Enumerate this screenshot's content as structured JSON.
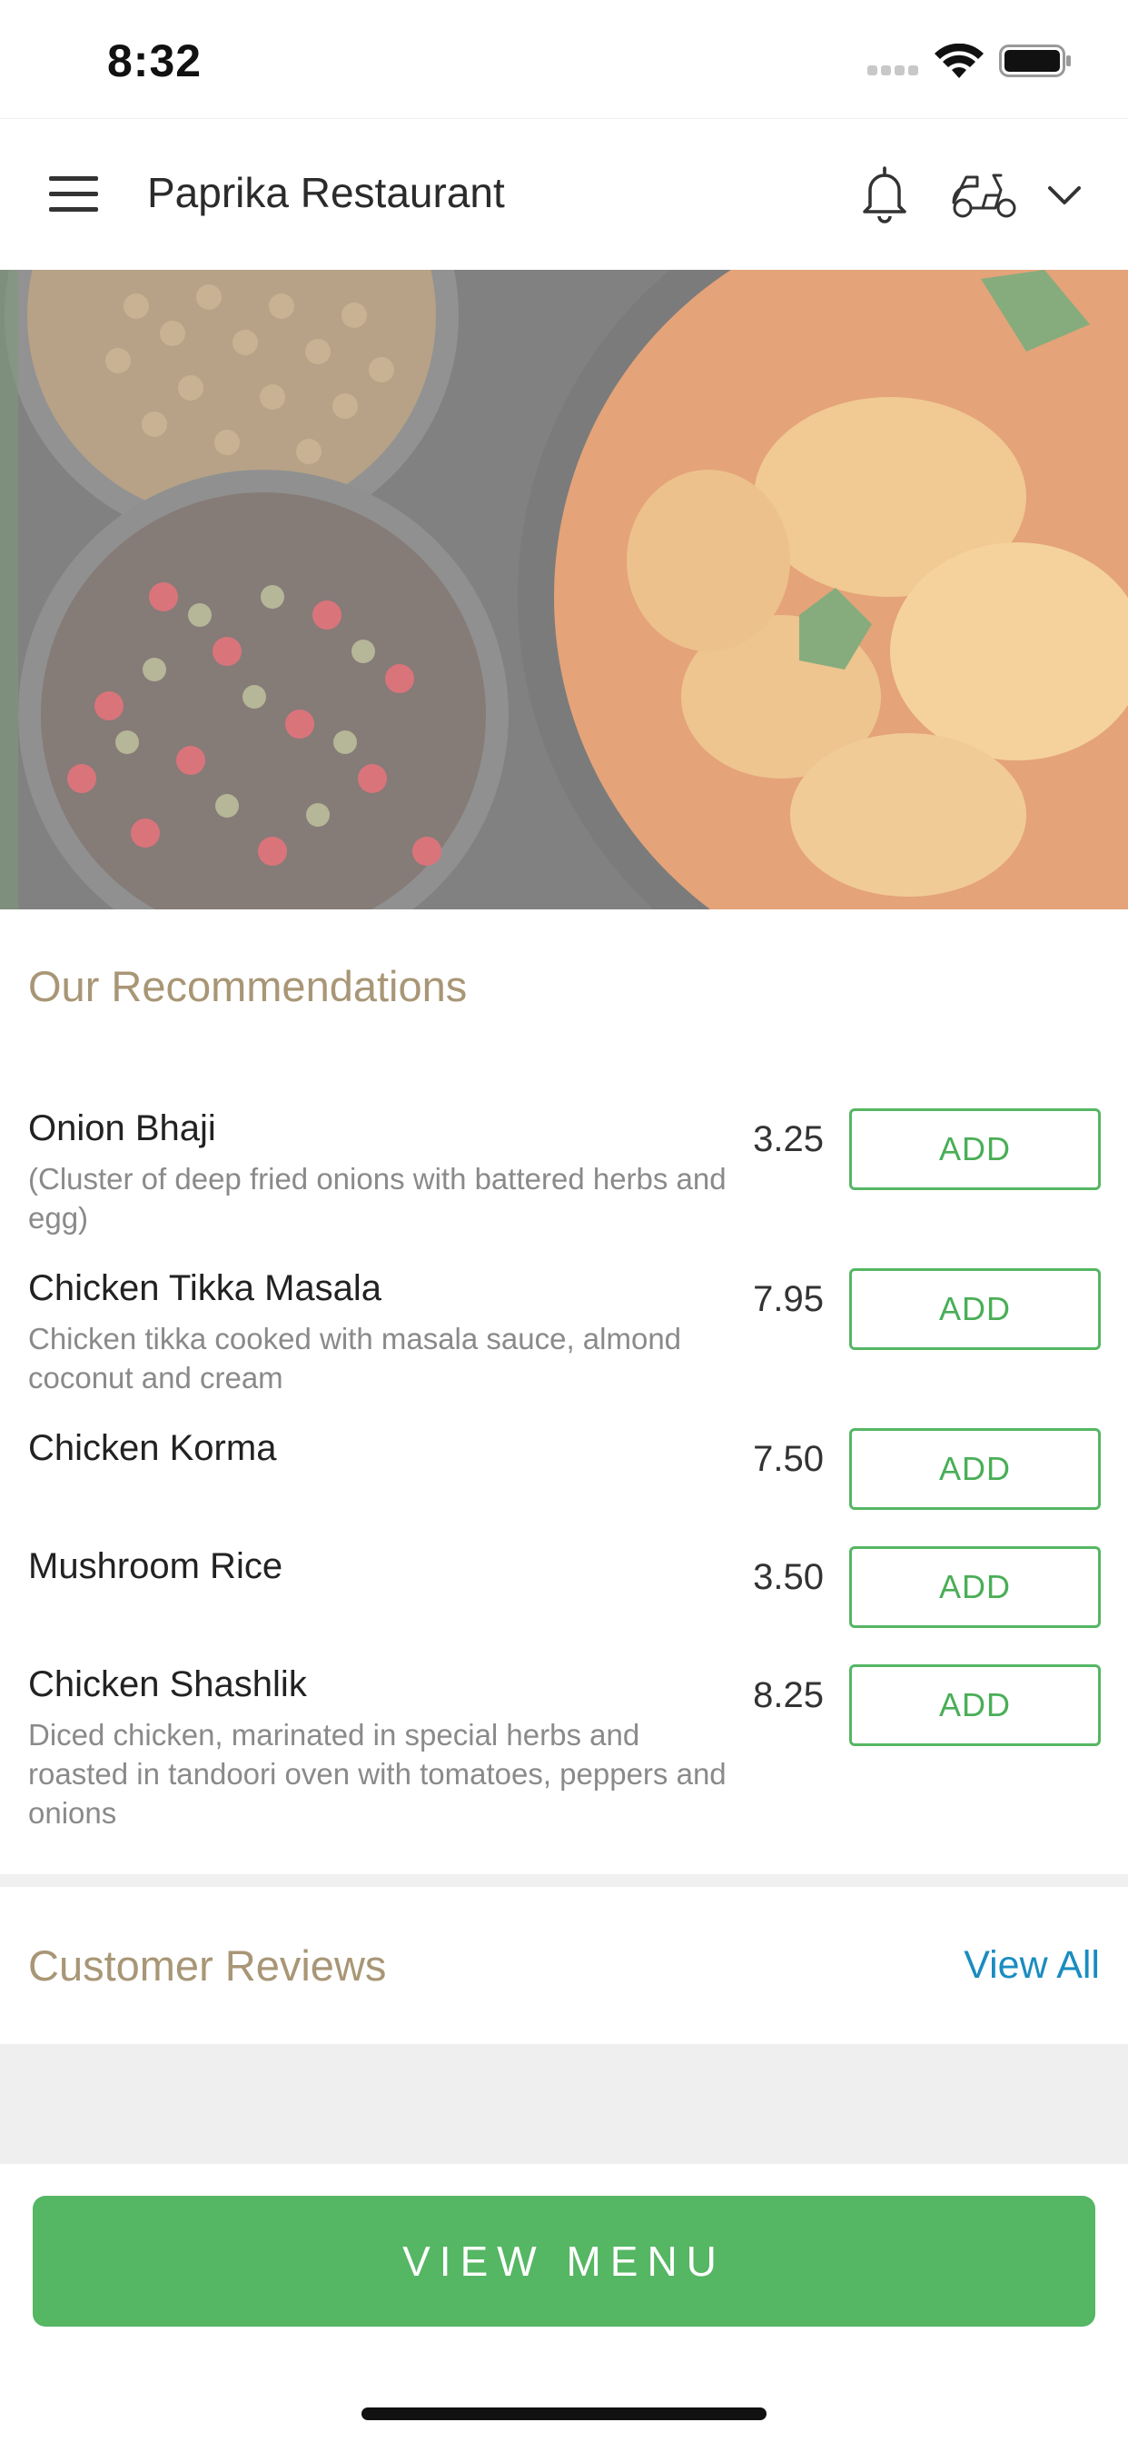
{
  "status_bar": {
    "time": "8:32",
    "icons": [
      "signal-icon",
      "wifi-icon",
      "battery-icon"
    ]
  },
  "header": {
    "title": "Paprika Restaurant",
    "icons": [
      "hamburger-menu-icon",
      "bell-icon",
      "scooter-icon",
      "chevron-down-icon"
    ]
  },
  "recommendations": {
    "title": "Our Recommendations",
    "add_label": "ADD",
    "items": [
      {
        "name": "Onion Bhaji",
        "description": "(Cluster of deep fried onions with battered herbs and egg)",
        "price": "3.25"
      },
      {
        "name": "Chicken Tikka Masala",
        "description": "Chicken tikka cooked with masala sauce, almond coconut and cream",
        "price": "7.95"
      },
      {
        "name": "Chicken Korma",
        "description": "",
        "price": "7.50"
      },
      {
        "name": "Mushroom Rice",
        "description": "",
        "price": "3.50"
      },
      {
        "name": "Chicken Shashlik",
        "description": "Diced chicken, marinated in special herbs and roasted in tandoori oven with tomatoes, peppers and onions",
        "price": "8.25"
      }
    ]
  },
  "reviews": {
    "title": "Customer Reviews",
    "view_all": "View All"
  },
  "footer": {
    "view_menu_label": "VIEW MENU"
  },
  "colors": {
    "accent_green": "#55b663",
    "section_title": "#a89676",
    "link_blue": "#1a8cc0"
  }
}
